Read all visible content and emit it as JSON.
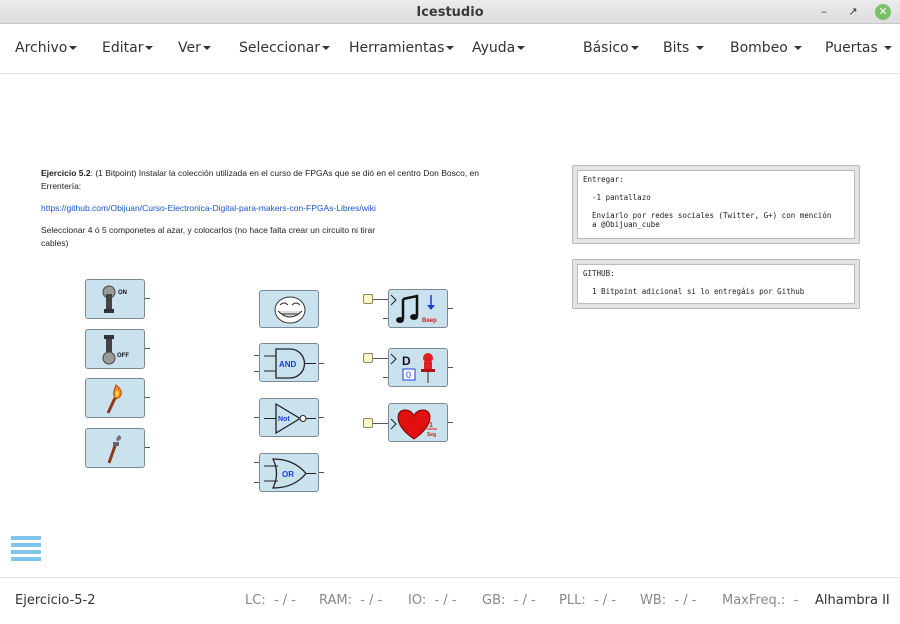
{
  "window": {
    "title": "Icestudio",
    "controls": [
      "minimize",
      "restore",
      "close"
    ]
  },
  "menubar": {
    "left": [
      "Archivo",
      "Editar",
      "Ver",
      "Seleccionar",
      "Herramientas",
      "Ayuda"
    ],
    "right": [
      "Básico",
      "Bits",
      "Bombeo",
      "Puertas"
    ]
  },
  "info": {
    "title": "Ejercicio 5.2",
    "text": ": (1 Bitpoint) Instalar la colección utilizada en el curso de FPGAs que se dió en el centro Don Bosco, en",
    "text2": "Errentería:",
    "link": "https://github.com/Obijuan/Curso-Electronica-Digital-para-makers-con-FPGAs-Libres/wiki",
    "instr1": "Seleccionar 4 ó 5 componetes al azar, y colocarlos (no hace falta crear un circuito ni tirar",
    "instr2": "cables)"
  },
  "notes": {
    "entregar": "Entregar:\n\n  -1 pantallazo\n\n  Enviarlo por redes sociales (Twitter, G+) con mención\n  a @Obijuan_cube",
    "github": "GITHUB:\n\n  1 Bitpoint adicional si lo entregáis por Github"
  },
  "blocks": {
    "switch_on": "ON",
    "switch_off": "OFF",
    "and": "AND",
    "not": "Not",
    "or": "OR",
    "beep": "Beep",
    "flipflop_d": "D",
    "flipflop_val": "0",
    "heart_num": "1",
    "heart_unit": "Seg"
  },
  "status": {
    "project": "Ejercicio-5-2",
    "lc_label": "LC:",
    "lc_val": "- / -",
    "ram_label": "RAM:",
    "ram_val": "- / -",
    "io_label": "IO:",
    "io_val": "- / -",
    "gb_label": "GB:",
    "gb_val": "- / -",
    "pll_label": "PLL:",
    "pll_val": "- / -",
    "wb_label": "WB:",
    "wb_val": "- / -",
    "maxfreq_label": "MaxFreq.:",
    "maxfreq_val": "-",
    "board": "Alhambra II"
  },
  "colors": {
    "block_fill": "#c9e2ee",
    "accent": "#7ec4ec",
    "close_btn": "#7bc06a"
  }
}
